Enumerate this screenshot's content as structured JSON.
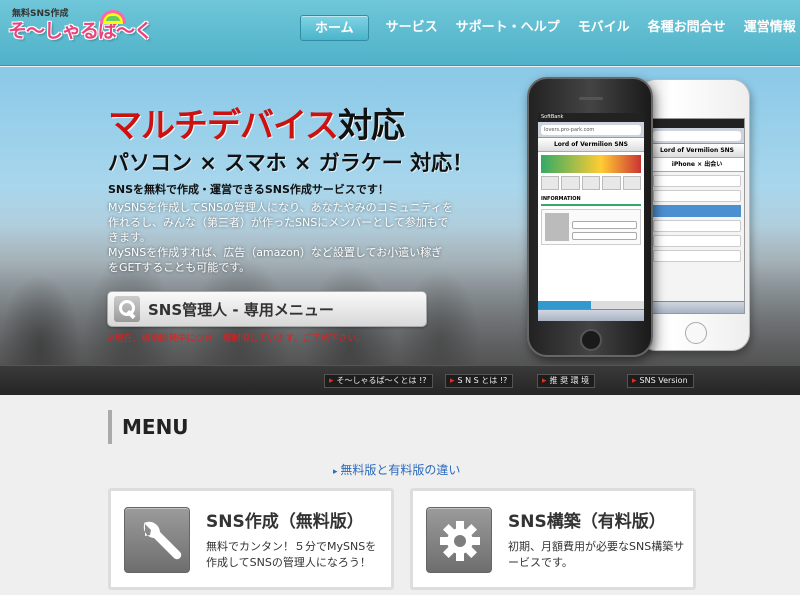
{
  "logo": {
    "subtitle": "無料SNS作成",
    "name": "そ〜しゃるぱ〜く"
  },
  "nav": [
    {
      "label": "ホーム"
    },
    {
      "label": "サービス"
    },
    {
      "label": "サポート・ヘルプ"
    },
    {
      "label": "モバイル"
    },
    {
      "label": "各種お問合せ"
    },
    {
      "label": "運営情報"
    }
  ],
  "hero": {
    "title_red": "マルチデバイス",
    "title_dark": "対応",
    "subtitle": "パソコン × スマホ × ガラケー 対応！",
    "description": "SNSを無料で作成・運営できるSNS作成サービスです！",
    "body1": "MySNSを作成してSNSの管理人になり、あなたやみのコミュニティを作れるし、みんな（第三者）が作ったSNSにメンバーとして参加もできます。",
    "body2": "MySNSを作成すれば、広告（amazon）など設置してお小遣い稼ぎをGETすることも可能です。",
    "admin_button": "SNS管理人 - 専用メニュー",
    "notice": "※現在、機能開発中につき一部制限しています。ご了承下さい。"
  },
  "phones": {
    "black": {
      "carrier": "SoftBank",
      "url": "lovers.pro-park.com",
      "site_title": "Lord of Vermilion SNS",
      "section": "INFORMATION"
    },
    "white": {
      "site_title": "Lord of Vermilion SNS",
      "header": "iPhone × 出会い"
    }
  },
  "infobar": [
    {
      "label": "そ〜しゃるぱ〜くとは !?"
    },
    {
      "label": "S N S とは !?"
    },
    {
      "label": "推 奨 環 境"
    },
    {
      "label": "SNS Version"
    }
  ],
  "menu": {
    "heading": "MENU",
    "compare_link": "無料版と有料版の違い",
    "cards": [
      {
        "title": "SNS作成（無料版）",
        "desc": "無料でカンタン！５分でMySNSを作成してSNSの管理人になろう！",
        "icon": "wrench-icon"
      },
      {
        "title": "SNS構築（有料版）",
        "desc": "初期、月額費用が必要なSNS構築サービスです。",
        "icon": "gear-icon"
      }
    ]
  }
}
